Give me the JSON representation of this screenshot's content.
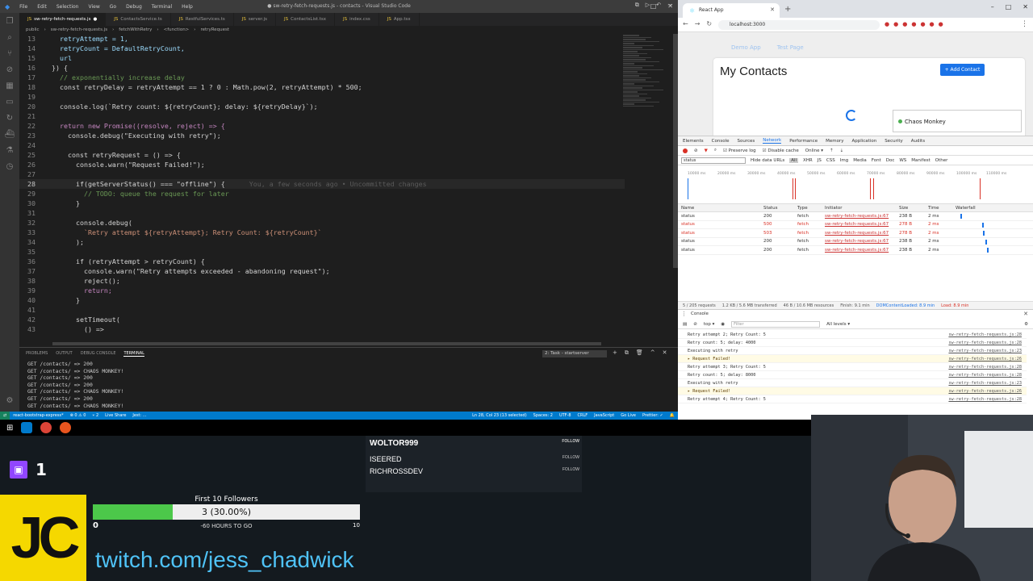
{
  "vscode": {
    "menu": [
      "File",
      "Edit",
      "Selection",
      "View",
      "Go",
      "Debug",
      "Terminal",
      "Help"
    ],
    "window_title": "● sw-retry-fetch-requests.js - contacts - Visual Studio Code",
    "tabs": [
      {
        "label": "sw-retry-fetch-requests.js",
        "active": true
      },
      {
        "label": "ContactsService.ts",
        "active": false
      },
      {
        "label": "RestfulServices.ts",
        "active": false
      },
      {
        "label": "server.js",
        "active": false
      },
      {
        "label": "ContactsList.tsx",
        "active": false
      },
      {
        "label": "index.css",
        "active": false
      },
      {
        "label": "App.tsx",
        "active": false
      }
    ],
    "breadcrumb": [
      "public",
      "sw-retry-fetch-requests.js",
      "fetchWithRetry",
      "<function>",
      "retryRequest"
    ],
    "code": [
      {
        "n": "13",
        "text": "    retryAttempt = 1,",
        "cls": "blue"
      },
      {
        "n": "14",
        "text": "    retryCount = DefaultRetryCount,",
        "cls": "blue"
      },
      {
        "n": "15",
        "text": "    url",
        "cls": "blue"
      },
      {
        "n": "16",
        "text": "  }) {",
        "cls": ""
      },
      {
        "n": "17",
        "text": "    // exponentially increase delay",
        "cls": "comment"
      },
      {
        "n": "18",
        "text": "    const retryDelay = retryAttempt == 1 ? 0 : Math.pow(2, retryAttempt) * 500;",
        "cls": ""
      },
      {
        "n": "19",
        "text": "",
        "cls": ""
      },
      {
        "n": "20",
        "text": "    console.log(`Retry count: ${retryCount}; delay: ${retryDelay}`);",
        "cls": ""
      },
      {
        "n": "21",
        "text": "",
        "cls": ""
      },
      {
        "n": "22",
        "text": "    return new Promise((resolve, reject) => {",
        "cls": "kw"
      },
      {
        "n": "23",
        "text": "      console.debug(\"Executing with retry\");",
        "cls": ""
      },
      {
        "n": "24",
        "text": "",
        "cls": ""
      },
      {
        "n": "25",
        "text": "      const retryRequest = () => {",
        "cls": ""
      },
      {
        "n": "26",
        "text": "        console.warn(\"Request Failed!\");",
        "cls": ""
      },
      {
        "n": "27",
        "text": "",
        "cls": ""
      },
      {
        "n": "28",
        "text": "        if(getServerStatus() === \"offline\") {",
        "cls": "",
        "cur": true
      },
      {
        "n": "29",
        "text": "          // TODO: queue the request for later",
        "cls": "comment"
      },
      {
        "n": "30",
        "text": "        }",
        "cls": ""
      },
      {
        "n": "31",
        "text": "",
        "cls": ""
      },
      {
        "n": "32",
        "text": "        console.debug(",
        "cls": ""
      },
      {
        "n": "33",
        "text": "          `Retry attempt ${retryAttempt}; Retry Count: ${retryCount}`",
        "cls": "str"
      },
      {
        "n": "34",
        "text": "        );",
        "cls": ""
      },
      {
        "n": "35",
        "text": "",
        "cls": ""
      },
      {
        "n": "36",
        "text": "        if (retryAttempt > retryCount) {",
        "cls": ""
      },
      {
        "n": "37",
        "text": "          console.warn(\"Retry attempts exceeded - abandoning request\");",
        "cls": ""
      },
      {
        "n": "38",
        "text": "          reject();",
        "cls": ""
      },
      {
        "n": "39",
        "text": "          return;",
        "cls": "kw"
      },
      {
        "n": "40",
        "text": "        }",
        "cls": ""
      },
      {
        "n": "41",
        "text": "",
        "cls": ""
      },
      {
        "n": "42",
        "text": "        setTimeout(",
        "cls": ""
      },
      {
        "n": "43",
        "text": "          () =>",
        "cls": ""
      }
    ],
    "blame": "You, a few seconds ago • Uncommitted changes",
    "panel_tabs": [
      "PROBLEMS",
      "OUTPUT",
      "DEBUG CONSOLE",
      "TERMINAL"
    ],
    "task_select": "2: Task - startserver",
    "terminal": [
      "GET /contacts/ => 200",
      "GET /contacts/ => CHAOS MONKEY!",
      "GET /contacts/ => 200",
      "GET /contacts/ => 200",
      "GET /contacts/ => CHAOS MONKEY!",
      "GET /contacts/ => 200",
      "GET /contacts/ => CHAOS MONKEY!"
    ],
    "status_left": [
      "react-bootstrap-express*",
      "⊗ 0 ⚠ 0",
      "⑂ 2",
      "Live Share",
      "Jest: ..."
    ],
    "status_right": [
      "Ln 28, Col 23 (13 selected)",
      "Spaces: 2",
      "UTF-8",
      "CRLF",
      "JavaScript",
      "Go Live",
      "Prettier: ✓"
    ]
  },
  "chrome": {
    "tab_title": "React App",
    "url": "localhost:3000",
    "page": {
      "nav_links": [
        "Demo App",
        "Test Page"
      ],
      "title": "My Contacts",
      "add_button": "+ Add Contact",
      "contact_name": "Chaos Monkey"
    },
    "devtools": {
      "tabs": [
        "Elements",
        "Console",
        "Sources",
        "Network",
        "Performance",
        "Memory",
        "Application",
        "Security",
        "Audits"
      ],
      "active_tab": "Network",
      "toolbar": [
        "Preserve log",
        "Disable cache",
        "Online"
      ],
      "filter_value": "status",
      "filter_types": [
        "Hide data URLs",
        "All",
        "XHR",
        "JS",
        "CSS",
        "Img",
        "Media",
        "Font",
        "Doc",
        "WS",
        "Manifest",
        "Other"
      ],
      "timeline_ticks": [
        "10000 ms",
        "20000 ms",
        "30000 ms",
        "40000 ms",
        "50000 ms",
        "60000 ms",
        "70000 ms",
        "80000 ms",
        "90000 ms",
        "100000 ms",
        "110000 ms"
      ],
      "columns": [
        "Name",
        "Status",
        "Type",
        "Initiator",
        "Size",
        "Time",
        "Waterfall"
      ],
      "rows": [
        {
          "name": "status",
          "status": "200",
          "type": "fetch",
          "initiator": "sw-retry-fetch-requests.js:67",
          "size": "238 B",
          "time": "2 ms",
          "error": false
        },
        {
          "name": "status",
          "status": "500",
          "type": "fetch",
          "initiator": "sw-retry-fetch-requests.js:67",
          "size": "278 B",
          "time": "2 ms",
          "error": true
        },
        {
          "name": "status",
          "status": "503",
          "type": "fetch",
          "initiator": "sw-retry-fetch-requests.js:67",
          "size": "278 B",
          "time": "2 ms",
          "error": true
        },
        {
          "name": "status",
          "status": "200",
          "type": "fetch",
          "initiator": "sw-retry-fetch-requests.js:67",
          "size": "238 B",
          "time": "2 ms",
          "error": false
        },
        {
          "name": "status",
          "status": "200",
          "type": "fetch",
          "initiator": "sw-retry-fetch-requests.js:67",
          "size": "238 B",
          "time": "2 ms",
          "error": false
        }
      ],
      "summary": [
        "5 / 205 requests",
        "1.2 KB / 5.6 MB transferred",
        "46 B / 10.6 MB resources",
        "Finish: 9.1 min",
        "DOMContentLoaded: 8.9 min",
        "Load: 8.9 min"
      ],
      "console_tab": "Console",
      "console_context": "top",
      "console_filter_placeholder": "Filter",
      "console_levels": "All levels ▾",
      "console": [
        {
          "text": "Retry attempt 2; Retry Count: 5",
          "src": "sw-retry-fetch-requests.js:28",
          "warn": false
        },
        {
          "text": "Retry count: 5; delay: 4000",
          "src": "sw-retry-fetch-requests.js:28",
          "warn": false
        },
        {
          "text": "Executing with retry",
          "src": "sw-retry-fetch-requests.js:23",
          "warn": false
        },
        {
          "text": "▸ Request Failed!",
          "src": "sw-retry-fetch-requests.js:26",
          "warn": true
        },
        {
          "text": "Retry attempt 3; Retry Count: 5",
          "src": "sw-retry-fetch-requests.js:28",
          "warn": false
        },
        {
          "text": "Retry count: 5; delay: 8000",
          "src": "sw-retry-fetch-requests.js:28",
          "warn": false
        },
        {
          "text": "Executing with retry",
          "src": "sw-retry-fetch-requests.js:23",
          "warn": false
        },
        {
          "text": "▸ Request Failed!",
          "src": "sw-retry-fetch-requests.js:26",
          "warn": true
        },
        {
          "text": "Retry attempt 4; Retry Count: 5",
          "src": "sw-retry-fetch-requests.js:28",
          "warn": false
        }
      ]
    }
  },
  "overlay": {
    "follower_count": "1",
    "followers": [
      "WOLTOR999",
      "ISEERED",
      "RICHROSSDEV"
    ],
    "follow_label": "FOLLOW",
    "goal": {
      "title": "First 10 Followers",
      "progress_text": "3 (30.00%)",
      "progress_fraction": 0.3,
      "min": "0",
      "max": "10",
      "remaining": "-60 HOURS TO GO"
    },
    "logo": "JC",
    "url": "twitch.com/jess_chadwick"
  }
}
